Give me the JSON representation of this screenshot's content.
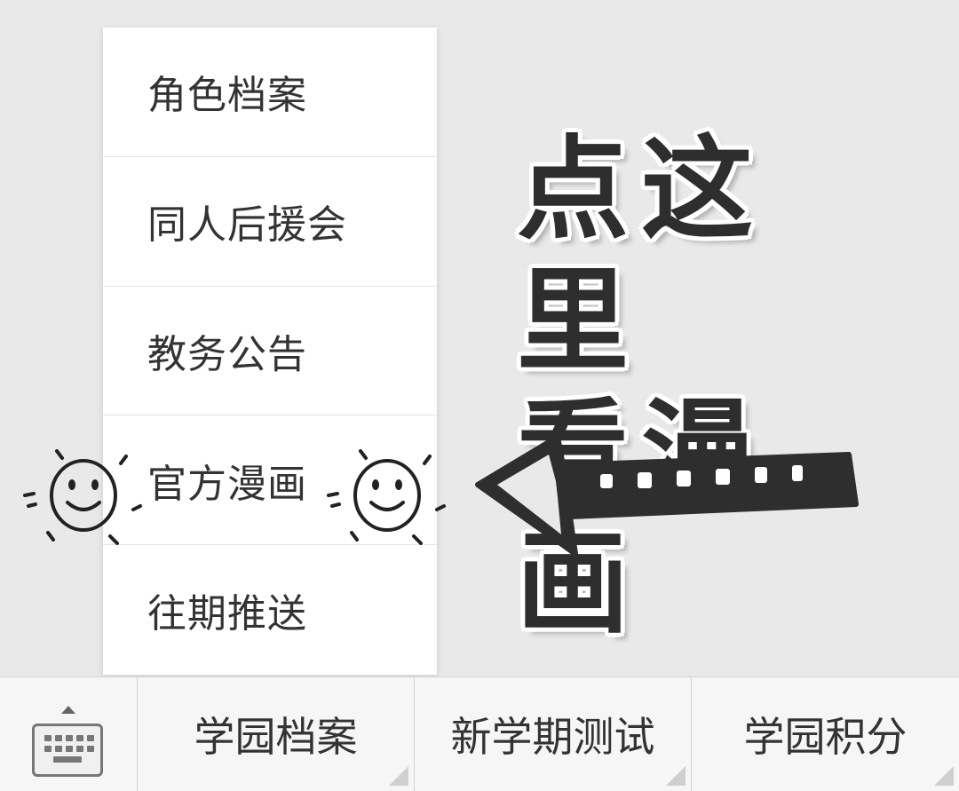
{
  "menu": {
    "items": [
      {
        "label": "角色档案"
      },
      {
        "label": "同人后援会"
      },
      {
        "label": "教务公告"
      },
      {
        "label": "官方漫画"
      },
      {
        "label": "往期推送"
      }
    ]
  },
  "callout": {
    "line1": "点这里",
    "line2": "看漫画"
  },
  "navbar": {
    "keyboard_icon": "keyboard-icon",
    "buttons": [
      {
        "label": "学园档案"
      },
      {
        "label": "新学期测试"
      },
      {
        "label": "学园积分"
      }
    ]
  },
  "colors": {
    "background": "#e9e9e9",
    "menu_bg": "#ffffff",
    "text": "#333333",
    "callout": "#2e2e2e"
  }
}
